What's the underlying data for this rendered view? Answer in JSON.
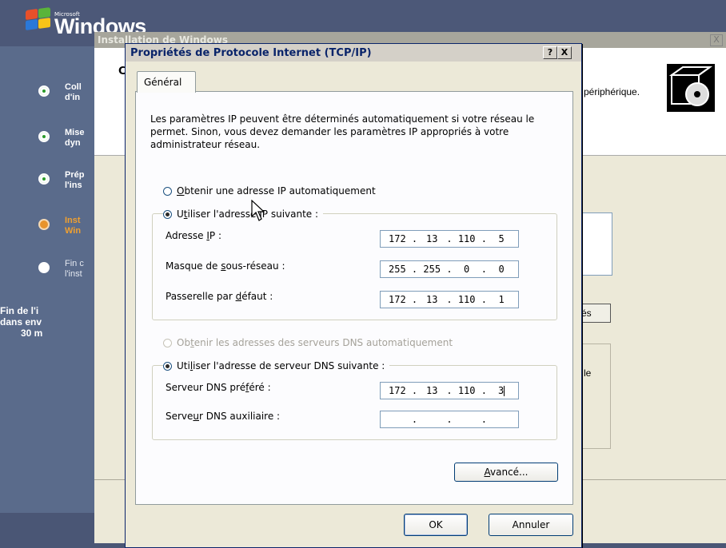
{
  "setup": {
    "ms_label": "Microsoft",
    "windows_label": "Windows",
    "steps": [
      {
        "label": "Coll",
        "label2": "d'in",
        "state": "done"
      },
      {
        "label": "Mise",
        "label2": "dyn",
        "state": "done"
      },
      {
        "label": "Prép",
        "label2": "l'ins",
        "state": "done"
      },
      {
        "label": "Inst",
        "label2": "Win",
        "state": "current"
      },
      {
        "label": "Fin c",
        "label2": "l'inst",
        "state": "pending"
      }
    ],
    "finish_line1": "Fin de l'i",
    "finish_line2": "dans env",
    "finish_line3": "30 m"
  },
  "install_window": {
    "title": "Installation de Windows",
    "close_label": "X",
    "header_char": "C",
    "header_text": "périphérique.",
    "button_partial": "és",
    "partial_text": "le"
  },
  "dialog": {
    "title": "Propriétés de Protocole Internet (TCP/IP)",
    "help_label": "?",
    "close_label": "X",
    "tab_label": "Général",
    "description": "Les paramètres IP peuvent être déterminés automatiquement si votre réseau le permet. Sinon, vous devez demander les paramètres IP appropriés à votre administrateur réseau.",
    "ip_auto_label": "btenir une adresse IP automatiquement",
    "ip_auto_key": "O",
    "ip_manual_label_pre": "U",
    "ip_manual_key": "t",
    "ip_manual_label_post": "iliser l'adresse IP suivante :",
    "ip_address_label_pre": "Adresse ",
    "ip_address_key": "I",
    "ip_address_label_post": "P :",
    "ip_address": [
      "172",
      "13",
      "110",
      "5"
    ],
    "subnet_label_pre": "Masque de ",
    "subnet_key": "s",
    "subnet_label_post": "ous-réseau :",
    "subnet": [
      "255",
      "255",
      "0",
      "0"
    ],
    "gateway_label_pre": "Passerelle par ",
    "gateway_key": "d",
    "gateway_label_post": "éfaut :",
    "gateway": [
      "172",
      "13",
      "110",
      "1"
    ],
    "dns_auto_label_pre": "Ob",
    "dns_auto_key": "t",
    "dns_auto_label_post": "enir les adresses des serveurs DNS automatiquement",
    "dns_manual_label_pre": "Uti",
    "dns_manual_key": "l",
    "dns_manual_label_post": "iser l'adresse de serveur DNS suivante :",
    "dns_pref_label_pre": "Serveur DNS pré",
    "dns_pref_key": "f",
    "dns_pref_label_post": "éré :",
    "dns_pref": [
      "172",
      "13",
      "110",
      "3"
    ],
    "dns_alt_label_pre": "Serve",
    "dns_alt_key": "u",
    "dns_alt_label_post": "r DNS auxiliaire :",
    "dns_alt": [
      "",
      "",
      "",
      ""
    ],
    "advanced_key": "A",
    "advanced_label": "vancé...",
    "ok_label": "OK",
    "cancel_label": "Annuler"
  }
}
